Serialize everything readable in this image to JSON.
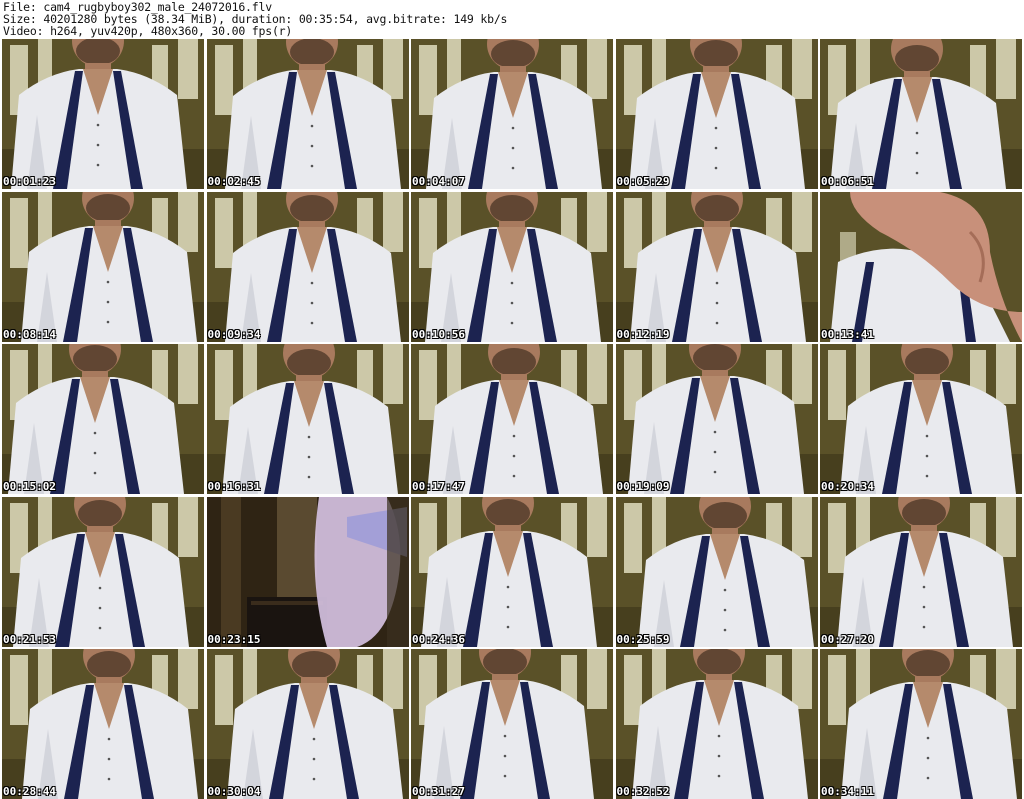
{
  "header": {
    "file_line": "File: cam4_rugbyboy302_male_24072016.flv",
    "size_line": "Size: 40201280 bytes (38.34 MiB), duration: 00:35:54, avg.bitrate: 149 kb/s",
    "video_line": "Video: h264, yuv420p, 480x360, 30.00 fps(r)"
  },
  "colors": {
    "background": "#ffffff",
    "wall": "#5a5128",
    "window_light": "#e8e6c8",
    "shirt": "#e9eaee",
    "tie": "#1c2350",
    "skin": "#a87a5e",
    "timestamp_text": "#ffffff"
  },
  "thumbnails": [
    {
      "timestamp": "00:01:23",
      "scene": "man-tie"
    },
    {
      "timestamp": "00:02:45",
      "scene": "man-tie"
    },
    {
      "timestamp": "00:04:07",
      "scene": "man-tie"
    },
    {
      "timestamp": "00:05:29",
      "scene": "man-tie"
    },
    {
      "timestamp": "00:06:51",
      "scene": "man-tie"
    },
    {
      "timestamp": "00:08:14",
      "scene": "man-tie"
    },
    {
      "timestamp": "00:09:34",
      "scene": "man-tie"
    },
    {
      "timestamp": "00:10:56",
      "scene": "man-tie"
    },
    {
      "timestamp": "00:12:19",
      "scene": "man-tie"
    },
    {
      "timestamp": "00:13:41",
      "scene": "hand"
    },
    {
      "timestamp": "00:15:02",
      "scene": "man-tie"
    },
    {
      "timestamp": "00:16:31",
      "scene": "man-tie"
    },
    {
      "timestamp": "00:17:47",
      "scene": "man-tie"
    },
    {
      "timestamp": "00:19:09",
      "scene": "man-tie"
    },
    {
      "timestamp": "00:20:34",
      "scene": "man-tie"
    },
    {
      "timestamp": "00:21:53",
      "scene": "man-tie"
    },
    {
      "timestamp": "00:23:15",
      "scene": "blurred-room"
    },
    {
      "timestamp": "00:24:36",
      "scene": "man-tie"
    },
    {
      "timestamp": "00:25:59",
      "scene": "man-tie"
    },
    {
      "timestamp": "00:27:20",
      "scene": "man-tie"
    },
    {
      "timestamp": "00:28:44",
      "scene": "man-tie"
    },
    {
      "timestamp": "00:30:04",
      "scene": "man-tie"
    },
    {
      "timestamp": "00:31:27",
      "scene": "man-tie"
    },
    {
      "timestamp": "00:32:52",
      "scene": "man-tie"
    },
    {
      "timestamp": "00:34:11",
      "scene": "man-tie"
    }
  ]
}
